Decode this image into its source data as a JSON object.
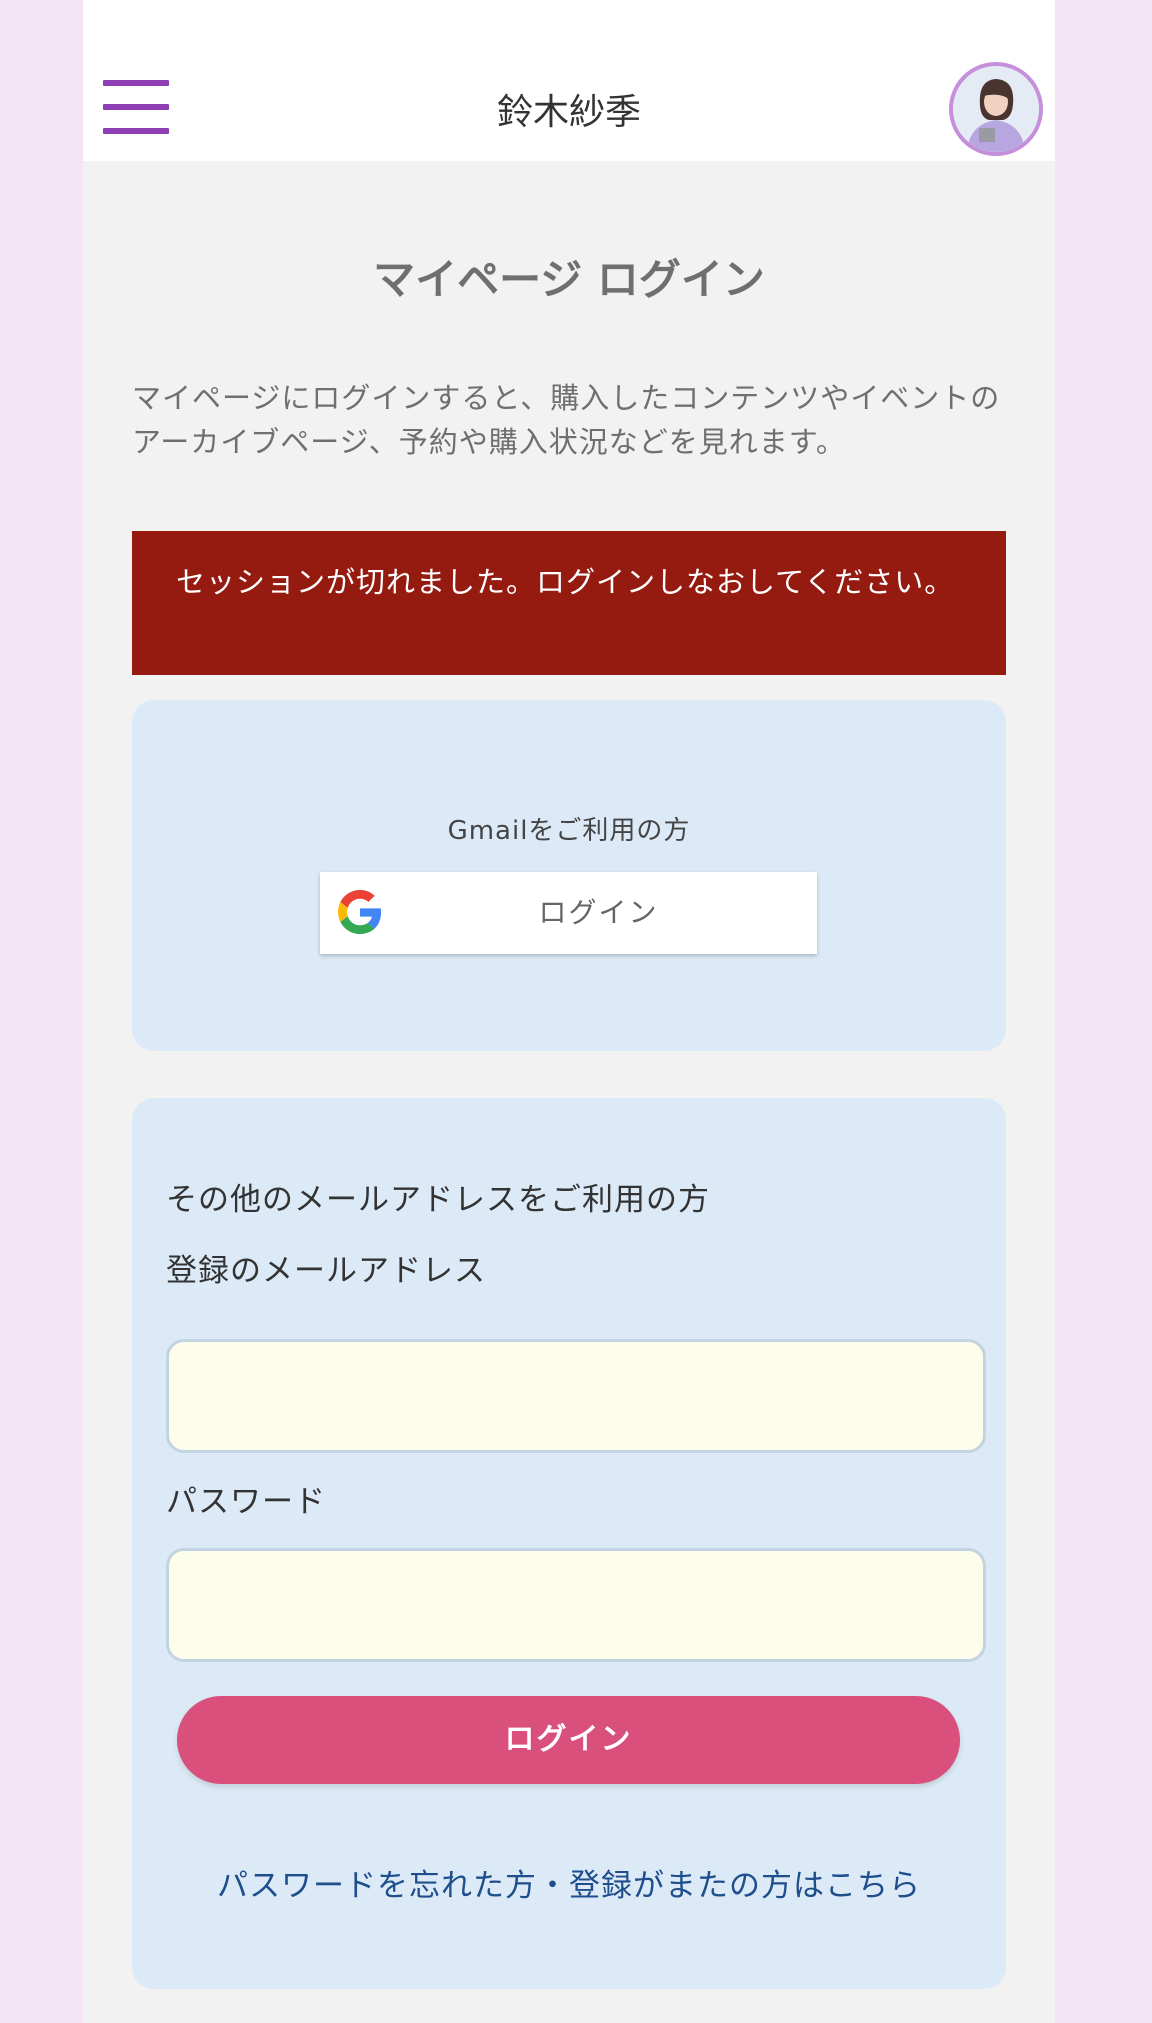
{
  "header": {
    "site_title": "鈴木紗季"
  },
  "login": {
    "title": "マイページ ログイン",
    "intro": "マイページにログインすると、購入したコンテンツやイベントのアーカイブページ、予約や購入状況などを見れます。",
    "alert": "セッションが切れました。ログインしなおしてください。",
    "gmail_label": "Gmailをご利用の方",
    "google_button_label": "ログイン",
    "other_heading": "その他のメールアドレスをご利用の方",
    "email_label": "登録のメールアドレス",
    "email_value": "",
    "password_label": "パスワード",
    "password_value": "",
    "submit_label": "ログイン",
    "forgot_link": "パスワードを忘れた方・登録がまたの方はこちら"
  },
  "colors": {
    "accent": "#8e3fb3",
    "alert_bg": "#951b11",
    "primary_button": "#d8507b",
    "card_bg": "#dceaf7",
    "input_bg": "#fdfdec",
    "link": "#1f4e8c"
  },
  "icons": {
    "menu": "hamburger-menu-icon",
    "avatar": "profile-avatar",
    "google": "google-logo-icon"
  }
}
